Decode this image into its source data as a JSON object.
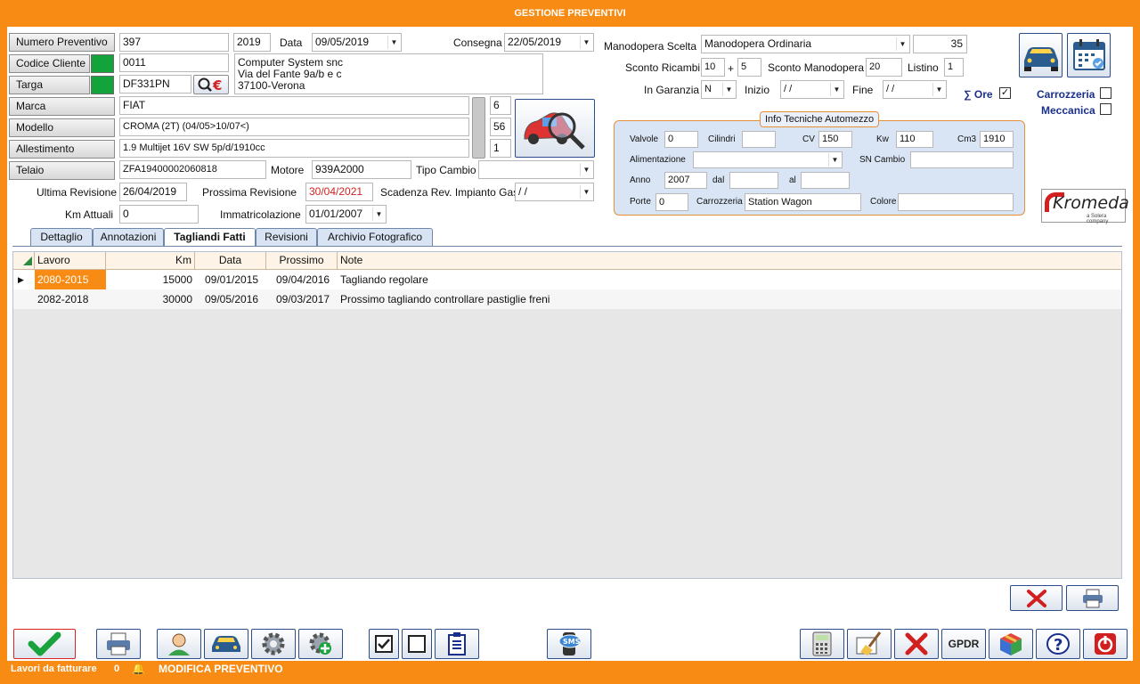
{
  "window": {
    "title": "GESTIONE PREVENTIVI"
  },
  "header": {
    "numero_preventivo_label": "Numero Preventivo",
    "numero_preventivo": "397",
    "anno": "2019",
    "data_label": "Data",
    "data": "09/05/2019",
    "consegna_label": "Consegna",
    "consegna": "22/05/2019",
    "codice_cliente_label": "Codice Cliente",
    "codice_cliente": "0011",
    "cliente_nome": "Computer System snc",
    "cliente_indirizzo": "Via del Fante 9a/b e c",
    "cliente_citta": "37100-Verona",
    "targa_label": "Targa",
    "targa": "DF331PN",
    "marca_label": "Marca",
    "marca": "FIAT",
    "marca_code": "6",
    "modello_label": "Modello",
    "modello": "CROMA (2T) (04/05>10/07<)",
    "modello_code": "56",
    "allestimento_label": "Allestimento",
    "allestimento": "1.9 Multijet 16V SW 5p/d/1910cc",
    "allestimento_code": "1",
    "telaio_label": "Telaio",
    "telaio": "ZFA19400002060818",
    "motore_label": "Motore",
    "motore": "939A2000",
    "tipo_cambio_label": "Tipo Cambio",
    "tipo_cambio": "",
    "ultima_revisione_label": "Ultima Revisione",
    "ultima_revisione": "26/04/2019",
    "prossima_revisione_label": "Prossima Revisione",
    "prossima_revisione": "30/04/2021",
    "scadenza_gas_label": "Scadenza Rev. Impianto Gas",
    "scadenza_gas": " / /",
    "km_attuali_label": "Km Attuali",
    "km_attuali": "0",
    "immatricolazione_label": "Immatricolazione",
    "immatricolazione": "01/01/2007"
  },
  "right": {
    "manodopera_scelta_label": "Manodopera Scelta",
    "manodopera_scelta": "Manodopera Ordinaria",
    "manodopera_value": "35",
    "sconto_ricambi_label": "Sconto Ricambi",
    "sconto_ricambi_1": "10",
    "plus": "+",
    "sconto_ricambi_2": "5",
    "sconto_manodopera_label": "Sconto Manodopera",
    "sconto_manodopera": "20",
    "listino_label": "Listino",
    "listino": "1",
    "in_garanzia_label": "In Garanzia",
    "in_garanzia": "N",
    "inizio_label": "Inizio",
    "inizio": " / /",
    "fine_label": "Fine",
    "fine": " / /",
    "sum_ore_label": "∑ Ore",
    "carrozzeria_label": "Carrozzeria",
    "meccanica_label": "Meccanica",
    "kromeda_label": "Kromeda",
    "kromeda_sub": "a Solera company"
  },
  "tech": {
    "legend": "Info Tecniche Automezzo",
    "valvole_label": "Valvole",
    "valvole": "0",
    "cilindri_label": "Cilindri",
    "cilindri": "",
    "cv_label": "CV",
    "cv": "150",
    "kw_label": "Kw",
    "kw": "110",
    "cm3_label": "Cm3",
    "cm3": "1910",
    "alimentazione_label": "Alimentazione",
    "alimentazione": "",
    "sn_cambio_label": "SN Cambio",
    "sn_cambio": "",
    "anno_label": "Anno",
    "anno": "2007",
    "dal_label": "dal",
    "dal": "",
    "al_label": "al",
    "al": "",
    "porte_label": "Porte",
    "porte": "0",
    "carrozzeria_label": "Carrozzeria",
    "carrozzeria": "Station Wagon",
    "colore_label": "Colore",
    "colore": ""
  },
  "tabs": [
    "Dettaglio",
    "Annotazioni",
    "Tagliandi Fatti",
    "Revisioni",
    "Archivio Fotografico"
  ],
  "grid": {
    "columns": [
      "Lavoro",
      "Km",
      "Data",
      "Prossimo",
      "Note"
    ],
    "rows": [
      {
        "lavoro": "2080-2015",
        "km": "15000",
        "data": "09/01/2015",
        "prossimo": "09/04/2016",
        "note": "Tagliando regolare"
      },
      {
        "lavoro": "2082-2018",
        "km": "30000",
        "data": "09/05/2016",
        "prossimo": "09/03/2017",
        "note": "Prossimo tagliando controllare pastiglie freni"
      }
    ]
  },
  "toolbar": {
    "gpdr_label": "GPDR",
    "sms_label": "SMS"
  },
  "status": {
    "lavori_label": "Lavori da fatturare",
    "lavori_count": "0",
    "mode": "MODIFICA PREVENTIVO"
  },
  "colors": {
    "accent": "#f78b13",
    "green": "#12a43a",
    "red_date": "#d21f1f",
    "selected_row": "#f78b13"
  }
}
